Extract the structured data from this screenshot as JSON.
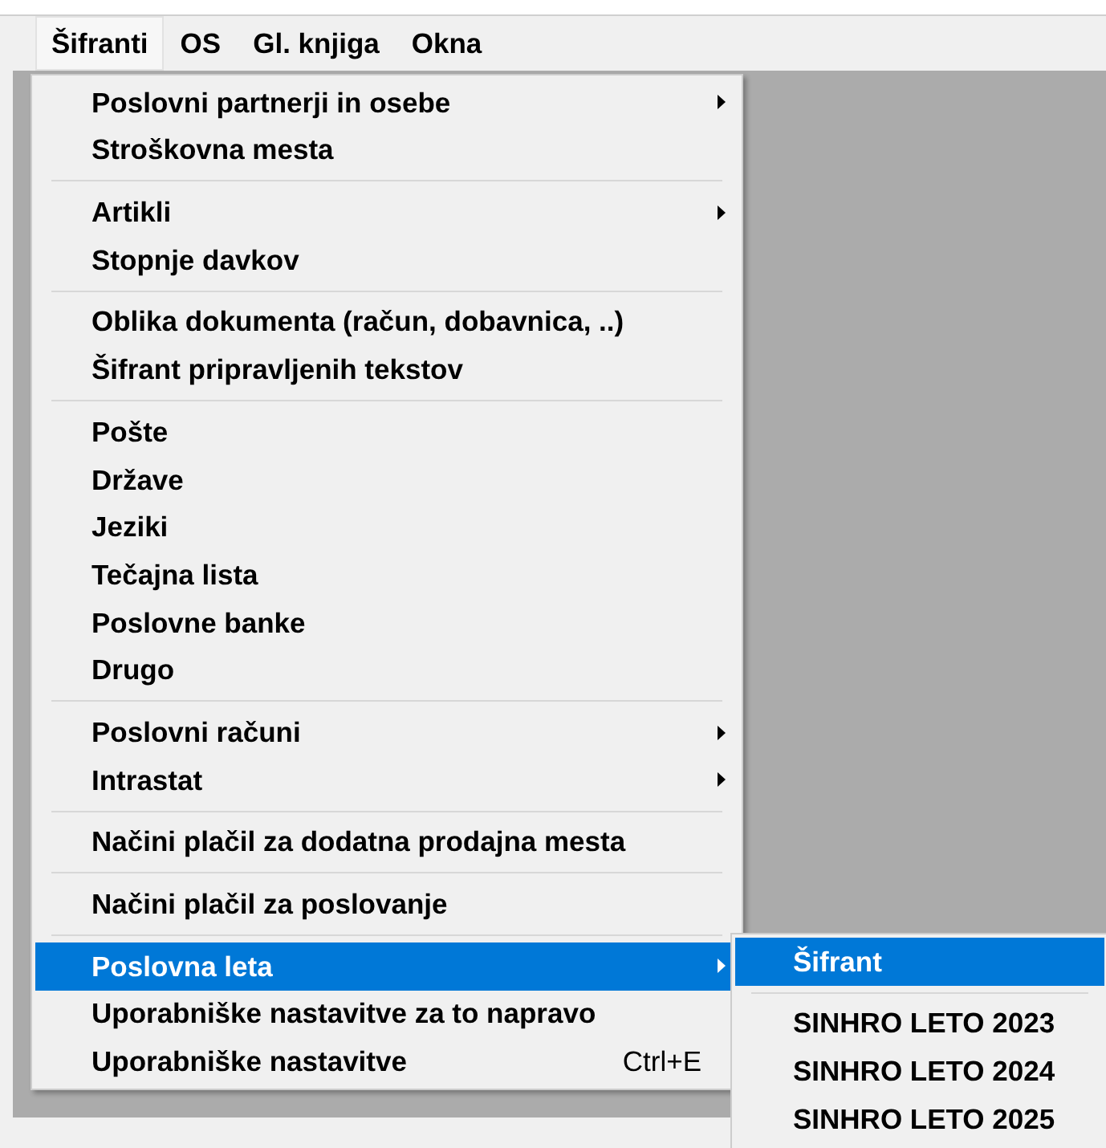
{
  "menubar": [
    {
      "label": "Šifranti",
      "selected": true
    },
    {
      "label": "OS",
      "selected": false
    },
    {
      "label": "Gl. knjiga",
      "selected": false
    },
    {
      "label": "Okna",
      "selected": false
    }
  ],
  "menu": {
    "groups": [
      [
        {
          "label": "Poslovni partnerji in osebe",
          "submenu": true,
          "selected": false
        },
        {
          "label": "Stroškovna mesta",
          "submenu": false,
          "selected": false
        }
      ],
      [
        {
          "label": "Artikli",
          "submenu": true,
          "selected": false
        },
        {
          "label": "Stopnje davkov",
          "submenu": false,
          "selected": false
        }
      ],
      [
        {
          "label": "Oblika dokumenta (račun, dobavnica, ..)",
          "submenu": false,
          "selected": false
        },
        {
          "label": "Šifrant pripravljenih tekstov",
          "submenu": false,
          "selected": false
        }
      ],
      [
        {
          "label": "Pošte",
          "submenu": false,
          "selected": false
        },
        {
          "label": "Države",
          "submenu": false,
          "selected": false
        },
        {
          "label": "Jeziki",
          "submenu": false,
          "selected": false
        },
        {
          "label": "Tečajna lista",
          "submenu": false,
          "selected": false
        },
        {
          "label": "Poslovne banke",
          "submenu": false,
          "selected": false
        },
        {
          "label": "Drugo",
          "submenu": false,
          "selected": false
        }
      ],
      [
        {
          "label": "Poslovni računi",
          "submenu": true,
          "selected": false
        },
        {
          "label": "Intrastat",
          "submenu": true,
          "selected": false
        }
      ],
      [
        {
          "label": "Načini plačil za dodatna prodajna mesta",
          "submenu": false,
          "selected": false
        }
      ],
      [
        {
          "label": "Načini plačil za poslovanje",
          "submenu": false,
          "selected": false
        }
      ],
      [
        {
          "label": "Poslovna leta",
          "submenu": true,
          "selected": true
        },
        {
          "label": "Uporabniške nastavitve za to napravo",
          "submenu": false,
          "selected": false
        },
        {
          "label": "Uporabniške nastavitve",
          "shortcut": "Ctrl+E",
          "submenu": false,
          "selected": false
        }
      ]
    ]
  },
  "submenu": {
    "groups": [
      [
        {
          "label": "Šifrant",
          "selected": true
        }
      ],
      [
        {
          "label": "SINHRO LETO 2023",
          "selected": false
        },
        {
          "label": "SINHRO LETO 2024",
          "selected": false
        },
        {
          "label": "SINHRO LETO 2025",
          "selected": false
        }
      ]
    ]
  }
}
